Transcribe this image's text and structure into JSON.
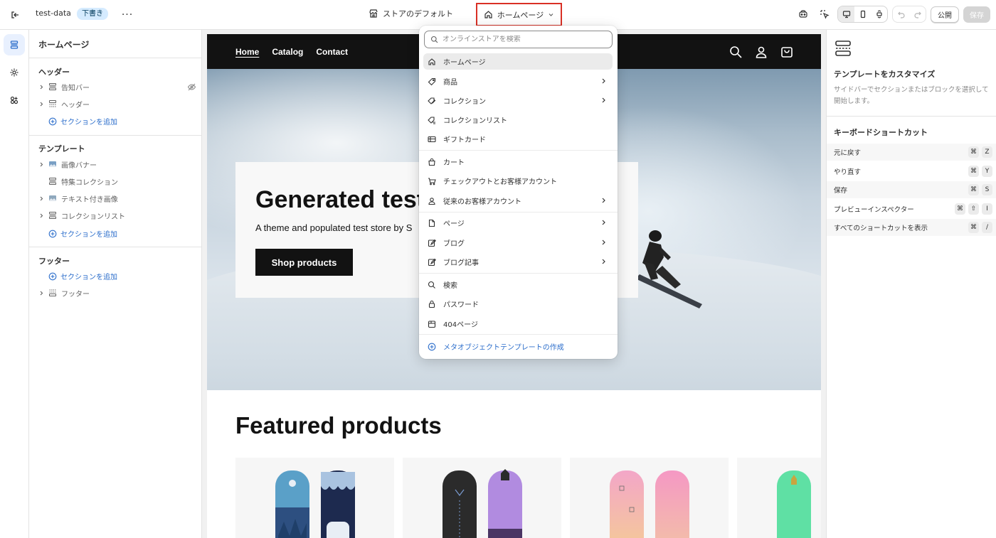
{
  "topbar": {
    "store_name": "test-data",
    "status_badge": "下書き",
    "more": "···",
    "theme_name": "ストアのデフォルト",
    "page_selector": "ホームページ",
    "publish_label": "公開",
    "save_label": "保存"
  },
  "sidebar": {
    "title": "ホームページ",
    "header_group": "ヘッダー",
    "header_items": [
      {
        "label": "告知バー"
      },
      {
        "label": "ヘッダー"
      }
    ],
    "add_section": "セクションを追加",
    "template_group": "テンプレート",
    "template_items": [
      {
        "label": "画像バナー"
      },
      {
        "label": "特集コレクション"
      },
      {
        "label": "テキスト付き画像"
      },
      {
        "label": "コレクションリスト"
      }
    ],
    "footer_group": "フッター",
    "footer_items": [
      {
        "label": "フッター"
      }
    ]
  },
  "preview": {
    "nav": [
      "Home",
      "Catalog",
      "Contact"
    ],
    "hero_title": "Generated test",
    "hero_subtitle": "A theme and populated test store by S",
    "hero_button": "Shop products",
    "featured_title": "Featured products"
  },
  "dropdown": {
    "search_placeholder": "オンラインストアを検索",
    "items": [
      {
        "label": "ホームページ",
        "icon": "home-icon"
      },
      {
        "label": "商品",
        "icon": "tag-icon"
      },
      {
        "label": "コレクション",
        "icon": "collection-icon"
      },
      {
        "label": "コレクションリスト",
        "icon": "collection-list-icon"
      },
      {
        "label": "ギフトカード",
        "icon": "gift-card-icon"
      },
      {
        "label": "カート",
        "icon": "cart-bag-icon"
      },
      {
        "label": "チェックアウトとお客様アカウント",
        "icon": "cart-icon"
      },
      {
        "label": "従来のお客様アカウント",
        "icon": "person-icon"
      },
      {
        "label": "ページ",
        "icon": "page-icon"
      },
      {
        "label": "ブログ",
        "icon": "blog-icon"
      },
      {
        "label": "ブログ記事",
        "icon": "blog-post-icon"
      },
      {
        "label": "検索",
        "icon": "search-icon"
      },
      {
        "label": "パスワード",
        "icon": "lock-icon"
      },
      {
        "label": "404ページ",
        "icon": "box-icon"
      },
      {
        "label": "メタオブジェクトテンプレートの作成",
        "icon": "plus-circle-icon"
      }
    ]
  },
  "rpanel": {
    "title": "テンプレートをカスタマイズ",
    "description": "サイドバーでセクションまたはブロックを選択して開始します。",
    "kb_title": "キーボードショートカット",
    "shortcuts": [
      {
        "label": "元に戻す",
        "keys": [
          "⌘",
          "Z"
        ]
      },
      {
        "label": "やり直す",
        "keys": [
          "⌘",
          "Y"
        ]
      },
      {
        "label": "保存",
        "keys": [
          "⌘",
          "S"
        ]
      },
      {
        "label": "プレビューインスペクター",
        "keys": [
          "⌘",
          "⇧",
          "I"
        ]
      },
      {
        "label": "すべてのショートカットを表示",
        "keys": [
          "⌘",
          "/"
        ]
      }
    ]
  },
  "colors": {
    "accent_blue": "#2c6ecb",
    "highlight_border": "#d93025",
    "storefront_dark": "#121212"
  }
}
